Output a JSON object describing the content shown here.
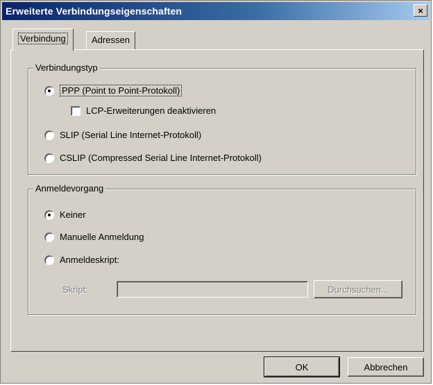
{
  "window": {
    "title": "Erweiterte Verbindungseigenschaften",
    "close_label": "×"
  },
  "tabs": [
    {
      "label": "Verbindung",
      "active": true
    },
    {
      "label": "Adressen",
      "active": false
    }
  ],
  "connection_type": {
    "legend": "Verbindungstyp",
    "ppp_label": "PPP (Point to Point-Protokoll)",
    "lcp_label": "LCP-Erweiterungen deaktivieren",
    "slip_label": "SLIP (Serial Line Internet-Protokoll)",
    "cslip_label": "CSLIP (Compressed Serial Line Internet-Protokoll)",
    "selected": "PPP"
  },
  "logon": {
    "legend": "Anmeldevorgang",
    "none_label": "Keiner",
    "manual_label": "Manuelle Anmeldung",
    "script_label": "Anmeldeskript:",
    "script_field_label": "Skript:",
    "script_value": "",
    "browse_label": "Durchsuchen...",
    "selected": "Keiner"
  },
  "footer": {
    "ok_label": "OK",
    "cancel_label": "Abbrechen"
  }
}
